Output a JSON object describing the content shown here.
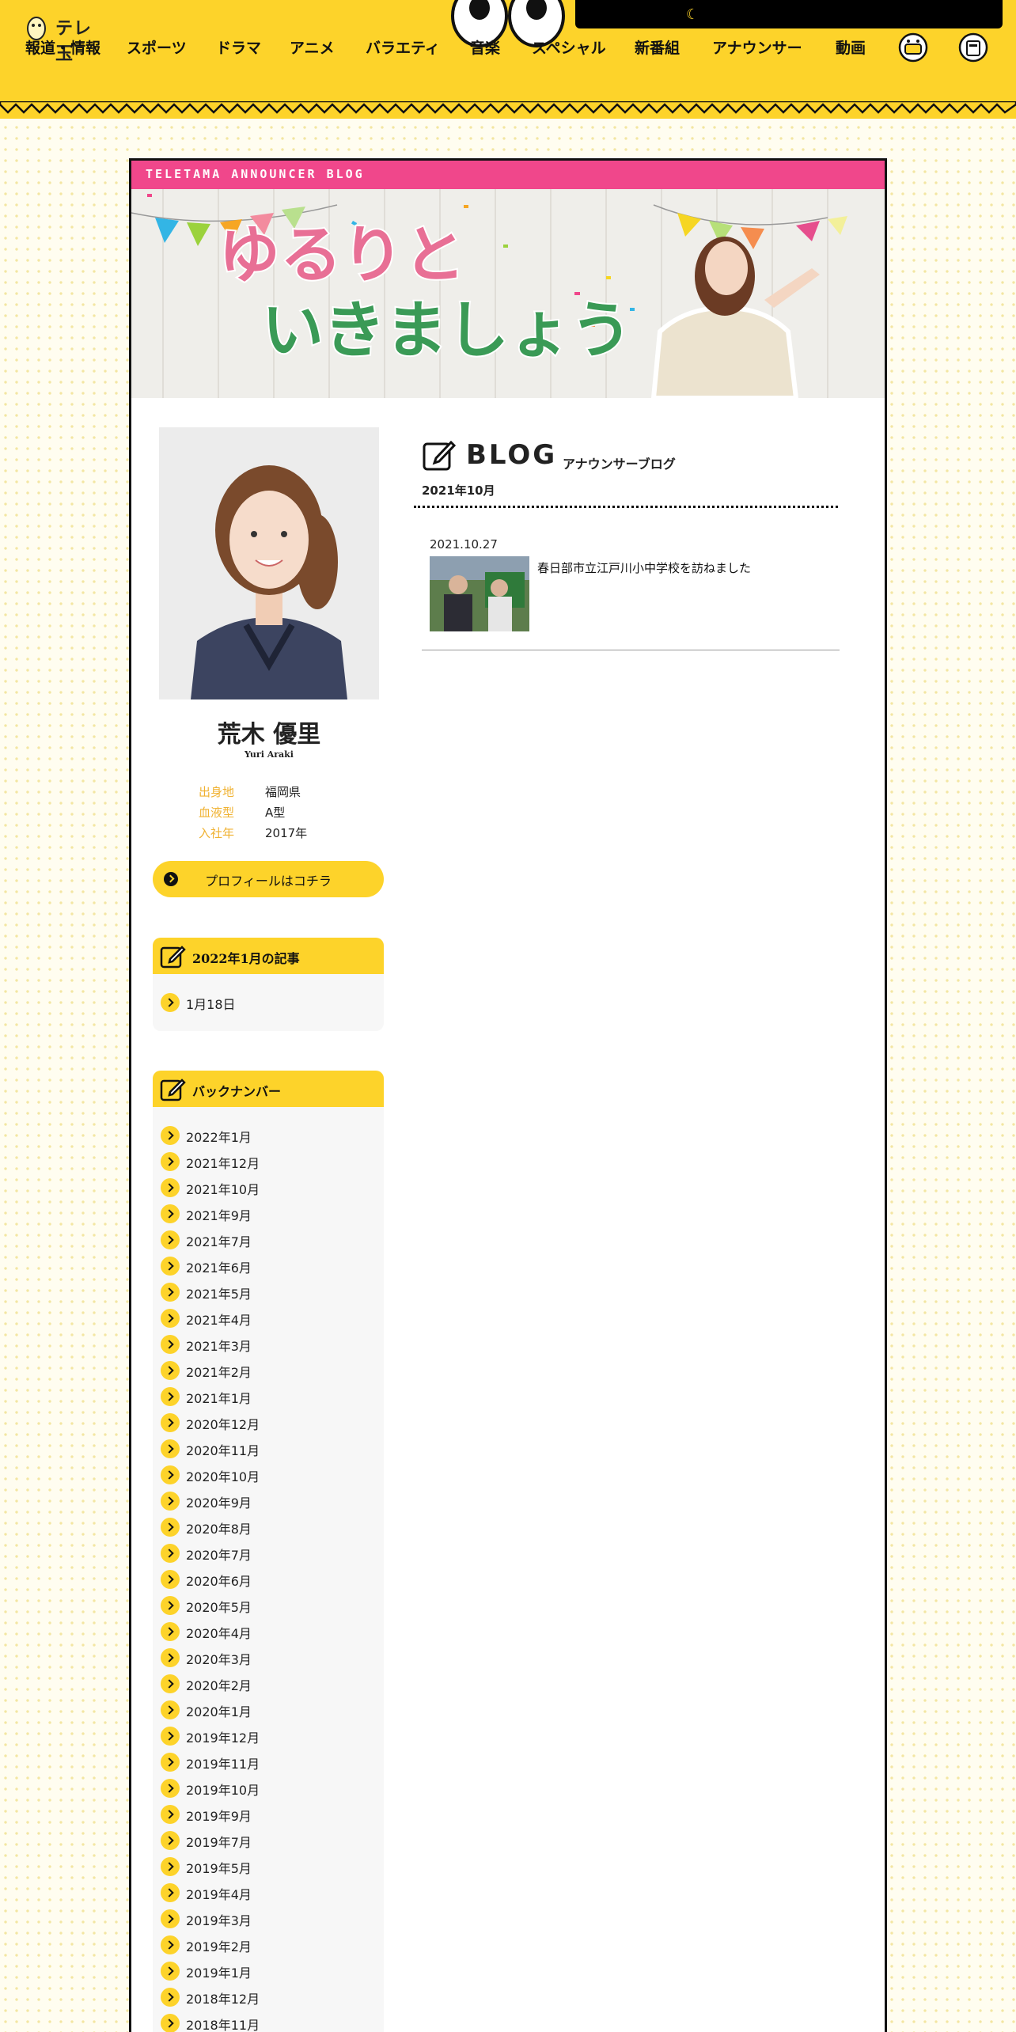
{
  "header": {
    "logo_text": "テレ玉",
    "nav": [
      "報道・情報",
      "スポーツ",
      "ドラマ",
      "アニメ",
      "バラエティ",
      "音楽",
      "スペシャル",
      "新番組",
      "アナウンサー",
      "動画"
    ],
    "search_icon": "search-icon",
    "mascot_icons": [
      "mascot-icon-1",
      "mascot-icon-2"
    ]
  },
  "banner": {
    "strip_text": "TELETAMA ANNOUNCER BLOG",
    "title_line1": "ゆるりと",
    "title_line2": "いきましょう"
  },
  "profile": {
    "name": "荒木 優里",
    "name_en": "Yuri Araki",
    "details": [
      {
        "key": "出身地",
        "value": "福岡県"
      },
      {
        "key": "血液型",
        "value": "A型"
      },
      {
        "key": "入社年",
        "value": "2017年"
      }
    ],
    "button_label": "プロフィールはコチラ"
  },
  "recent_widget": {
    "title": "2022年1月の記事",
    "items": [
      "1月18日"
    ]
  },
  "archive_widget": {
    "title": "バックナンバー",
    "items": [
      "2022年1月",
      "2021年12月",
      "2021年10月",
      "2021年9月",
      "2021年7月",
      "2021年6月",
      "2021年5月",
      "2021年4月",
      "2021年3月",
      "2021年2月",
      "2021年1月",
      "2020年12月",
      "2020年11月",
      "2020年10月",
      "2020年9月",
      "2020年8月",
      "2020年7月",
      "2020年6月",
      "2020年5月",
      "2020年4月",
      "2020年3月",
      "2020年2月",
      "2020年1月",
      "2019年12月",
      "2019年11月",
      "2019年10月",
      "2019年9月",
      "2019年7月",
      "2019年5月",
      "2019年4月",
      "2019年3月",
      "2019年2月",
      "2019年1月",
      "2018年12月",
      "2018年11月"
    ]
  },
  "blog": {
    "title": "BLOG",
    "subtitle": "アナウンサーブログ",
    "month": "2021年10月",
    "posts": [
      {
        "date": "2021.10.27",
        "title": "春日部市立江戸川小中学校を訪ねました"
      }
    ]
  },
  "colors": {
    "brand_yellow": "#fdd32a",
    "banner_pink": "#f0478b",
    "profile_key": "#f0b232"
  }
}
